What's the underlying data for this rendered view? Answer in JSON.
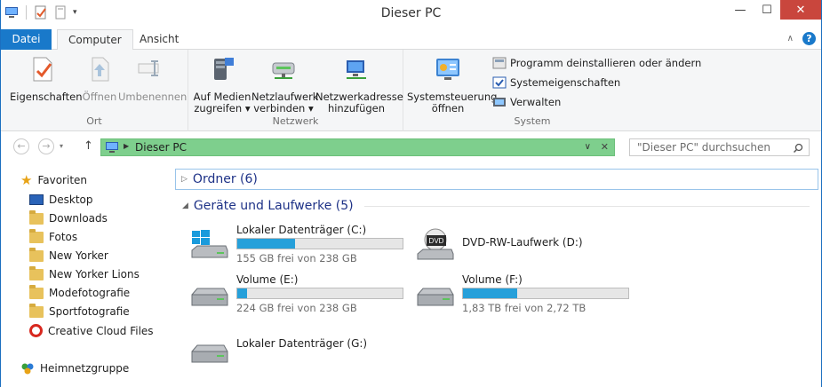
{
  "window": {
    "title": "Dieser PC"
  },
  "tabs": {
    "file": "Datei",
    "computer": "Computer",
    "view": "Ansicht"
  },
  "ribbon": {
    "ort": {
      "label": "Ort",
      "properties": "Eigenschaften",
      "open": "Öffnen",
      "rename": "Umbenennen"
    },
    "netzwerk": {
      "label": "Netzwerk",
      "media_l1": "Auf Medien",
      "media_l2": "zugreifen",
      "map_l1": "Netzlaufwerk",
      "map_l2": "verbinden",
      "addr_l1": "Netzwerkadresse",
      "addr_l2": "hinzufügen"
    },
    "system": {
      "label": "System",
      "control_l1": "Systemsteuerung",
      "control_l2": "öffnen",
      "uninstall": "Programm deinstallieren oder ändern",
      "sysprops": "Systemeigenschaften",
      "manage": "Verwalten"
    }
  },
  "address": {
    "path": "Dieser PC",
    "search_placeholder": "\"Dieser PC\" durchsuchen"
  },
  "sidebar": {
    "favorites": "Favoriten",
    "items": [
      "Desktop",
      "Downloads",
      "Fotos",
      "New Yorker",
      "New Yorker Lions",
      "Modefotografie",
      "Sportfotografie",
      "Creative Cloud Files"
    ],
    "homegroup": "Heimnetzgruppe"
  },
  "content": {
    "folders_header": "Ordner (6)",
    "devices_header": "Geräte und Laufwerke (5)",
    "drives": [
      {
        "name": "Lokaler Datenträger (C:)",
        "free": "155 GB frei von 238 GB",
        "used_fraction": 0.35
      },
      {
        "name": "DVD-RW-Laufwerk (D:)"
      },
      {
        "name": "Volume (E:)",
        "free": "224 GB frei von 238 GB",
        "used_fraction": 0.06
      },
      {
        "name": "Volume (F:)",
        "free": "1,83 TB frei von 2,72 TB",
        "used_fraction": 0.33
      },
      {
        "name": "Lokaler Datenträger (G:)"
      }
    ]
  },
  "colors": {
    "accent": "#1979ca",
    "address_highlight": "#7ecf8d",
    "bar_fill": "#26a0da",
    "close": "#c9463d"
  }
}
